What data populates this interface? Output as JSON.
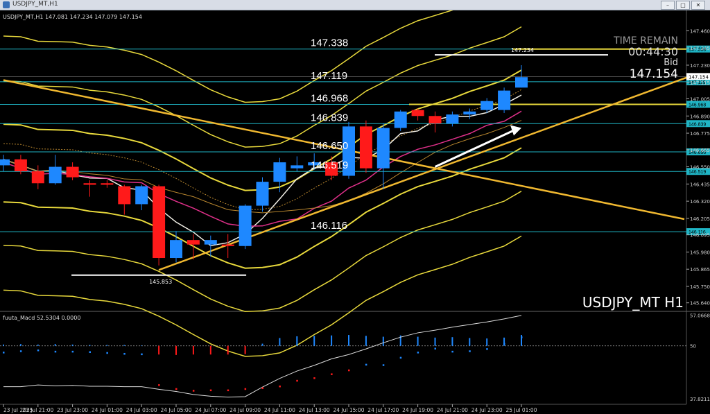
{
  "window": {
    "title": "USDJPY_MT,H1",
    "buttons": [
      "–",
      "□",
      "✕"
    ]
  },
  "chart_data": {
    "type": "candlestick",
    "symbol_header": "USDJPY_MT,H1 147.081 147.234 147.079 147.154",
    "watermark": "USDJPY_MT H1",
    "info_panel": {
      "label1": "TIME REMAIN",
      "time": "00:44:30",
      "label2": "Bid",
      "bid": "147.154"
    },
    "price_axis_ticks": [
      "147.460",
      "147.345",
      "147.230",
      "147.115",
      "147.005",
      "146.890",
      "146.775",
      "146.665",
      "146.550",
      "146.435",
      "146.320",
      "146.205",
      "146.095",
      "145.980",
      "145.865",
      "145.750",
      "145.640"
    ],
    "ylim": [
      145.62,
      147.55
    ],
    "levels": [
      {
        "value": 147.338,
        "label": "147.338",
        "tag": "147.338"
      },
      {
        "value": 147.119,
        "label": "147.119",
        "tag": "147.119"
      },
      {
        "value": 146.968,
        "label": "146.968",
        "tag": "146.968"
      },
      {
        "value": 146.839,
        "label": "146.839",
        "tag": "146.839"
      },
      {
        "value": 146.65,
        "label": "146.650",
        "tag": "146.650"
      },
      {
        "value": 146.519,
        "label": "146.519",
        "tag": "146.519"
      },
      {
        "value": 146.116,
        "label": "146.116",
        "tag": "146.116"
      }
    ],
    "current_price_tag": "147.154",
    "high_marker": {
      "value": 147.234,
      "label": "147.234"
    },
    "low_marker": {
      "value": 145.853,
      "label": "145.853"
    },
    "time_labels": [
      "23 Jul 2025",
      "23 Jul 21:00",
      "23 Jul 23:00",
      "24 Jul 01:00",
      "24 Jul 03:00",
      "24 Jul 05:00",
      "24 Jul 07:00",
      "24 Jul 09:00",
      "24 Jul 11:00",
      "24 Jul 13:00",
      "24 Jul 15:00",
      "24 Jul 17:00",
      "24 Jul 19:00",
      "24 Jul 21:00",
      "24 Jul 23:00",
      "25 Jul 01:00"
    ],
    "candles": [
      {
        "o": 146.56,
        "h": 146.63,
        "l": 146.52,
        "c": 146.6
      },
      {
        "o": 146.6,
        "h": 146.63,
        "l": 146.5,
        "c": 146.52
      },
      {
        "o": 146.52,
        "h": 146.56,
        "l": 146.4,
        "c": 146.44
      },
      {
        "o": 146.44,
        "h": 146.63,
        "l": 146.43,
        "c": 146.55
      },
      {
        "o": 146.55,
        "h": 146.58,
        "l": 146.46,
        "c": 146.48
      },
      {
        "o": 146.44,
        "h": 146.46,
        "l": 146.35,
        "c": 146.43
      },
      {
        "o": 146.44,
        "h": 146.46,
        "l": 146.41,
        "c": 146.43
      },
      {
        "o": 146.42,
        "h": 146.43,
        "l": 146.23,
        "c": 146.3
      },
      {
        "o": 146.3,
        "h": 146.43,
        "l": 146.26,
        "c": 146.42
      },
      {
        "o": 146.42,
        "h": 146.43,
        "l": 145.89,
        "c": 145.94
      },
      {
        "o": 145.94,
        "h": 146.12,
        "l": 145.91,
        "c": 146.06
      },
      {
        "o": 146.06,
        "h": 146.1,
        "l": 145.93,
        "c": 146.03
      },
      {
        "o": 146.03,
        "h": 146.09,
        "l": 145.95,
        "c": 146.06
      },
      {
        "o": 146.03,
        "h": 146.1,
        "l": 145.94,
        "c": 146.02
      },
      {
        "o": 146.02,
        "h": 146.3,
        "l": 146.0,
        "c": 146.29
      },
      {
        "o": 146.29,
        "h": 146.48,
        "l": 146.25,
        "c": 146.45
      },
      {
        "o": 146.45,
        "h": 146.61,
        "l": 146.38,
        "c": 146.58
      },
      {
        "o": 146.54,
        "h": 146.62,
        "l": 146.52,
        "c": 146.56
      },
      {
        "o": 146.56,
        "h": 146.64,
        "l": 146.53,
        "c": 146.58
      },
      {
        "o": 146.58,
        "h": 146.62,
        "l": 146.46,
        "c": 146.49
      },
      {
        "o": 146.49,
        "h": 146.85,
        "l": 146.47,
        "c": 146.82
      },
      {
        "o": 146.82,
        "h": 146.86,
        "l": 146.51,
        "c": 146.54
      },
      {
        "o": 146.54,
        "h": 146.84,
        "l": 146.4,
        "c": 146.81
      },
      {
        "o": 146.81,
        "h": 146.93,
        "l": 146.79,
        "c": 146.92
      },
      {
        "o": 146.93,
        "h": 146.94,
        "l": 146.86,
        "c": 146.89
      },
      {
        "o": 146.89,
        "h": 146.92,
        "l": 146.78,
        "c": 146.84
      },
      {
        "o": 146.84,
        "h": 146.92,
        "l": 146.82,
        "c": 146.9
      },
      {
        "o": 146.9,
        "h": 146.94,
        "l": 146.87,
        "c": 146.92
      },
      {
        "o": 146.93,
        "h": 147.01,
        "l": 146.91,
        "c": 146.99
      },
      {
        "o": 146.93,
        "h": 147.08,
        "l": 146.91,
        "c": 147.06
      },
      {
        "o": 147.08,
        "h": 147.23,
        "l": 147.08,
        "c": 147.15
      }
    ],
    "macd_panel": {
      "label": "fuuta_Macd 52.5304  0.0000",
      "ticks": [
        "57.0668",
        "50",
        "37.8211"
      ],
      "ylim": [
        37.5,
        57.3
      ],
      "bars": [
        50.3,
        50.4,
        50.3,
        50.4,
        50.3,
        50.2,
        50.2,
        50.2,
        50.1,
        48.0,
        47.9,
        48.0,
        48.0,
        48.0,
        48.1,
        50.5,
        51.8,
        52.2,
        52.3,
        52.4,
        52.5,
        52.3,
        52.1,
        52.4,
        52.1,
        51.9,
        52.0,
        51.8,
        51.7,
        51.9,
        52.5
      ],
      "line": [
        40.6,
        40.6,
        41.0,
        40.8,
        40.9,
        40.7,
        40.7,
        40.6,
        40.6,
        40.0,
        39.5,
        38.8,
        38.4,
        38.2,
        38.3,
        40.5,
        42.5,
        44.2,
        45.5,
        47.0,
        48.0,
        49.3,
        50.7,
        52.0,
        53.0,
        53.6,
        54.3,
        54.9,
        55.5,
        56.2,
        57.0
      ],
      "dots": [
        48.5,
        48.8,
        49.0,
        48.7,
        48.7,
        48.6,
        48.4,
        48.2,
        48.1,
        41.0,
        40.1,
        39.7,
        39.8,
        39.8,
        40.1,
        40.3,
        40.7,
        42.0,
        42.6,
        43.5,
        44.4,
        45.7,
        45.6,
        47.3,
        48.5,
        49.4,
        48.7,
        48.8,
        49.3,
        50.5,
        52.0
      ]
    },
    "colors": {
      "bull": "#1e88ff",
      "bear": "#ff1a1a",
      "level": "#1fb5c5",
      "band": "#e8d93c",
      "trend": "#f0b830",
      "ma_white": "#f2efe6",
      "ma_pink": "#e0308a",
      "ma_orange": "#b8862e"
    }
  }
}
